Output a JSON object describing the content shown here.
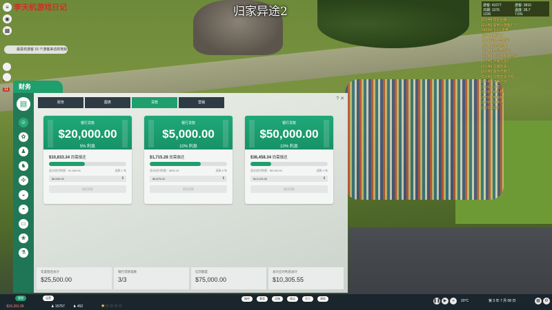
{
  "overlay": {
    "title": "归家异途2",
    "watermark": "李天机游戏日记"
  },
  "notification": {
    "text": "最喜欢游客 15 个游客来访的地标"
  },
  "counters": [
    {
      "value": "3"
    },
    {
      "value": "11"
    }
  ],
  "top_stats": {
    "items": [
      "游客: 41077",
      "游客: 3810",
      "日期: 1376",
      "温度: 28.7",
      "1236",
      "7.6%"
    ]
  },
  "chat": {
    "lines": [
      "[19:44] 欢迎回来",
      "[19:45] 看到小游客们了",
      "24094门口人流量",
      "[19:45] 我来了",
      "Trader进入直播间",
      "[19:46] 好好玩哈",
      "[19:46] 吃瓜群众+1",
      "[19:47] 这个游戏叫什么",
      "[19:47] 归家异途2",
      "[19:48] 主播加油",
      "[19:48] 金币不够了",
      "[19:49] 贷款还清了吗",
      "[19:49] 还差一点",
      "[19:50] 厉害",
      "[19:50] 刷礼物",
      "[19:51] 哈哈哈",
      "[19:51] 好多人",
      "[19:52] 666"
    ]
  },
  "finance": {
    "panel_title": "财务",
    "tabs": [
      {
        "label": "财务",
        "active": false
      },
      {
        "label": "图表",
        "active": false
      },
      {
        "label": "贷款",
        "active": true
      },
      {
        "label": "营销",
        "active": false
      }
    ],
    "window_controls": "? ✕",
    "loans": [
      {
        "label": "银行贷款",
        "amount": "$20,000.00",
        "rate": "5% 利息",
        "remaining": "$10,833.34",
        "remaining_label": "尚需偿还",
        "progress": 0.46,
        "interest_label": "总计应付利息：$1,666.66",
        "term": "还款 1 年",
        "selected": "$5,000.00",
        "repay_label": "偿还贷款"
      },
      {
        "label": "银行贷款",
        "amount": "$5,000.00",
        "rate": "10% 利息",
        "remaining": "$1,715.28",
        "remaining_label": "尚需偿还",
        "progress": 0.66,
        "interest_label": "总计应付利息：$583.34",
        "term": "还款 6 年",
        "selected": "$5,875.00",
        "repay_label": "偿还贷款"
      },
      {
        "label": "银行贷款",
        "amount": "$50,000.00",
        "rate": "10% 利息",
        "remaining": "$36,458.34",
        "remaining_label": "尚需偿还",
        "progress": 0.27,
        "interest_label": "总计应付利息：$8,055.55",
        "term": "还款 4 年",
        "selected": "$13,125.00",
        "repay_label": "偿还贷款"
      }
    ],
    "summary": [
      {
        "label": "年度偿还总计",
        "value": "$25,500.00"
      },
      {
        "label": "银行贷款笔数",
        "value": "3/3"
      },
      {
        "label": "信贷额度",
        "value": "$75,000.00"
      },
      {
        "label": "总计应付利息总计",
        "value": "$10,305.55"
      }
    ]
  },
  "bottom_bar": {
    "money": "-$15,391.06",
    "guests": "15757",
    "staff": "452",
    "rating_stars": 1,
    "mode_buttons": [
      "管理",
      "运营"
    ],
    "temperature": "20°C",
    "date": "第 3 年 7 月 08 日",
    "tools": [
      "路径",
      "景观",
      "设施",
      "商店",
      "员工",
      "建筑"
    ]
  }
}
